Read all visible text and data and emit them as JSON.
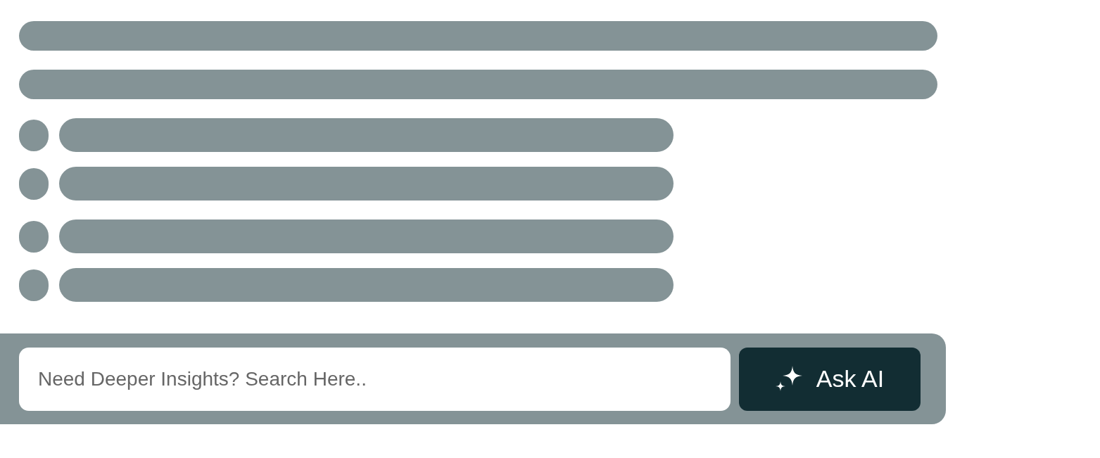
{
  "skeleton": [
    {
      "kind": "line"
    },
    {
      "kind": "line"
    },
    {
      "kind": "bullets",
      "children": [
        {
          "kind": "bullet"
        },
        {
          "kind": "bullet"
        }
      ]
    },
    {
      "kind": "bullets",
      "children": [
        {
          "kind": "bullet"
        },
        {
          "kind": "bullet"
        }
      ]
    }
  ],
  "search": {
    "placeholder": "Need Deeper Insights? Search Here..",
    "button": "Ask AI"
  }
}
